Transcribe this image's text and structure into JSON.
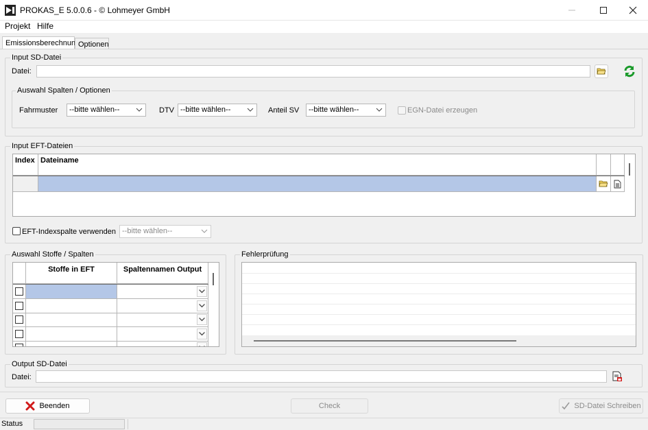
{
  "window": {
    "title": "PROKAS_E 5.0.0.6 - © Lohmeyer GmbH"
  },
  "menu": {
    "items": [
      "Projekt",
      "Hilfe"
    ]
  },
  "tabs": [
    {
      "label": "Emissionsberechnung",
      "active": true
    },
    {
      "label": "Optionen",
      "active": false
    }
  ],
  "input_sd": {
    "group_label": "Input SD-Datei",
    "file_label": "Datei:",
    "file_value": "",
    "options_group_label": "Auswahl Spalten / Optionen",
    "fahrmuster_label": "Fahrmuster",
    "fahrmuster_value": "--bitte wählen--",
    "dtv_label": "DTV",
    "dtv_value": "--bitte wählen--",
    "anteil_sv_label": "Anteil SV",
    "anteil_sv_value": "--bitte wählen--",
    "egn_label": "EGN-Datei erzeugen"
  },
  "input_eft": {
    "group_label": "Input EFT-Dateien",
    "columns": [
      "Index",
      "Dateiname"
    ],
    "index_check_label": "EFT-Indexspalte verwenden",
    "index_combo_value": "--bitte wählen--"
  },
  "stoffe": {
    "group_label": "Auswahl Stoffe / Spalten",
    "columns": [
      "Stoffe in EFT",
      "Spaltennamen Output"
    ]
  },
  "fehler": {
    "group_label": "Fehlerprüfung"
  },
  "output_sd": {
    "group_label": "Output SD-Datei",
    "file_label": "Datei:",
    "file_value": ""
  },
  "buttons": {
    "beenden": "Beenden",
    "check": "Check",
    "schreiben": "SD-Datei Schreiben"
  },
  "status": {
    "label": "Status"
  },
  "colors": {
    "selection": "#b4c7e7",
    "exit_red": "#d11a1a",
    "refresh_green": "#1a9a2a",
    "folder_yellow": "#f4d35e"
  }
}
